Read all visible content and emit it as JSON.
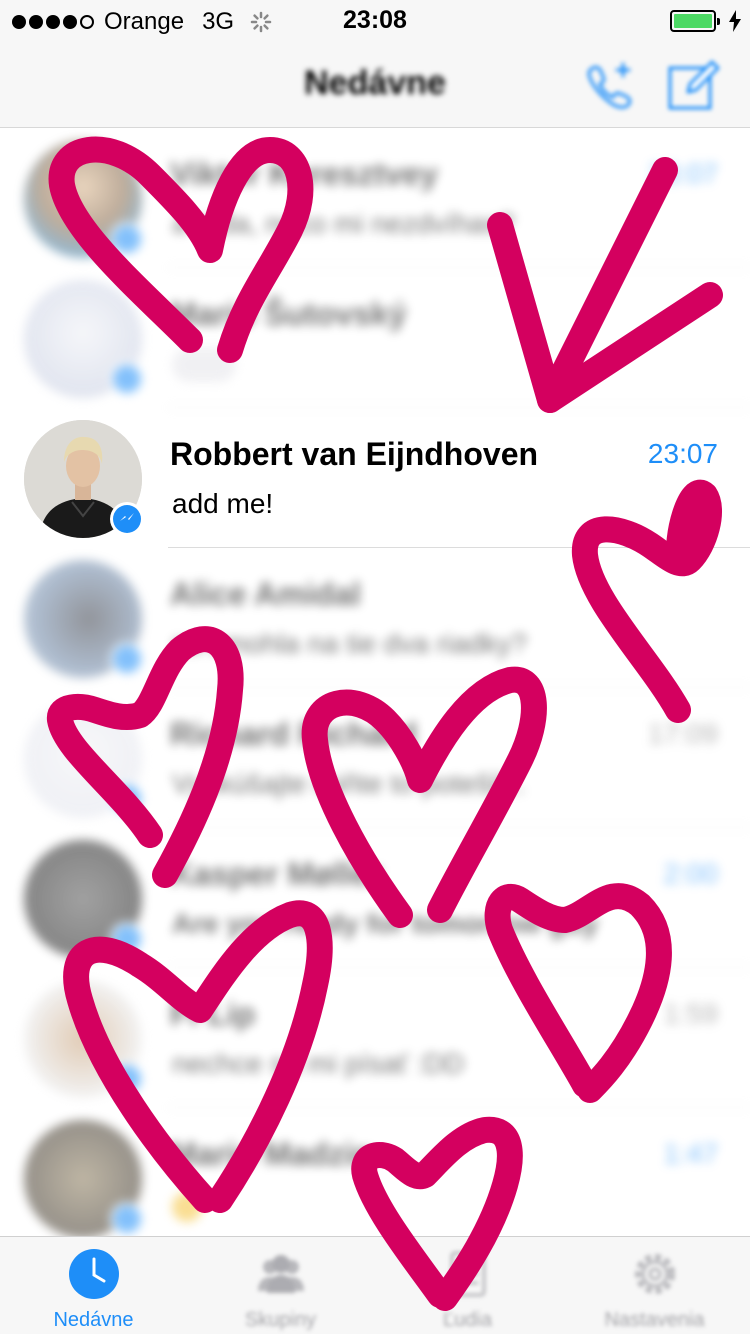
{
  "status_bar": {
    "carrier": "Orange",
    "network": "3G",
    "time": "23:08"
  },
  "nav": {
    "title": "Nedávne"
  },
  "conversations": [
    {
      "name": "Viktor Keresztvey",
      "message": "a teda, neco mi nezdvíhas?",
      "time": "23:07",
      "unread": true
    },
    {
      "name": "Mario Šutovský",
      "message": "",
      "time": "",
      "unread": false,
      "typing": true
    },
    {
      "name": "Robbert van Eijndhoven",
      "message": "add me!",
      "time": "23:07",
      "unread": true
    },
    {
      "name": "Alice Amidal",
      "message": "sa zmohla na tie dva riadky?",
      "time": "",
      "unread": false
    },
    {
      "name": "Richard Richard",
      "message": "Vyskúšajte miňte to potešil...",
      "time": "17:09",
      "unread": false
    },
    {
      "name": "Kasper Møller",
      "message": "Are you ready for tomorrow guy",
      "time": "2:00",
      "unread": true
    },
    {
      "name": "Fi Lip",
      "message": "nechce sa mi písať :DD",
      "time": "1:59",
      "unread": false
    },
    {
      "name": "Mario Madzin",
      "message": "",
      "time": "1:47",
      "unread": true
    }
  ],
  "tabs": [
    {
      "label": "Nedávne",
      "icon": "clock-icon",
      "active": true
    },
    {
      "label": "Skupiny",
      "icon": "group-icon",
      "active": false
    },
    {
      "label": "Ľudia",
      "icon": "people-list-icon",
      "active": false
    },
    {
      "label": "Nastavenia",
      "icon": "gear-icon",
      "active": false
    }
  ],
  "colors": {
    "accent": "#1e8ef8",
    "doodle": "#d4005f",
    "battery": "#4cd964"
  }
}
